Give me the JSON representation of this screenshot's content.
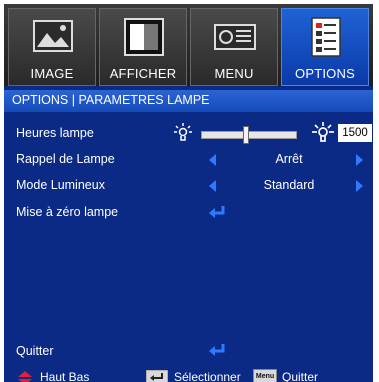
{
  "tabs": [
    {
      "label": "IMAGE",
      "icon": "image-icon"
    },
    {
      "label": "AFFICHER",
      "icon": "display-icon"
    },
    {
      "label": "MENU",
      "icon": "projector-icon"
    },
    {
      "label": "OPTIONS",
      "icon": "options-icon",
      "active": true
    }
  ],
  "title": "OPTIONS | PARAMETRES LAMPE",
  "rows": {
    "hours": {
      "label": "Heures lampe",
      "value": "1500",
      "level": 0.45
    },
    "reminder": {
      "label": "Rappel de Lampe",
      "value": "Arrêt"
    },
    "mode": {
      "label": "Mode Lumineux",
      "value": "Standard"
    },
    "reset": {
      "label": "Mise à zéro lampe"
    }
  },
  "quit": "Quitter",
  "footer": {
    "move": "Haut Bas",
    "select": "Sélectionner",
    "menu_key": "Menu",
    "quit": "Quitter"
  },
  "colors": {
    "accent": "#2f7bff",
    "panel": "#0b2a86",
    "active_tab": "#1f62d6"
  }
}
